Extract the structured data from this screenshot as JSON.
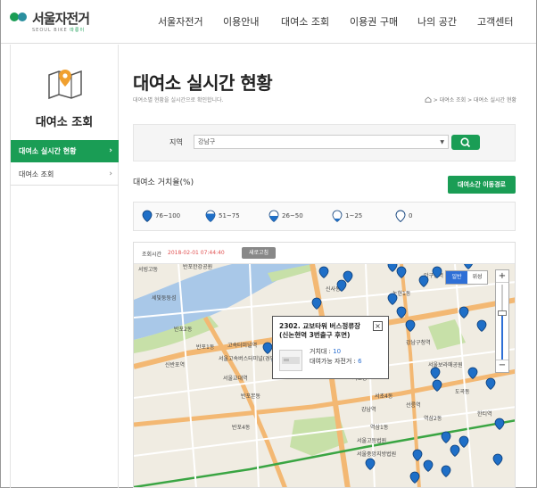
{
  "header": {
    "logo_text": "서울자전거",
    "logo_sub": "SEOUL BIKE",
    "logo_sub_brand": "따릉이",
    "nav": [
      "서울자전거",
      "이용안내",
      "대여소 조회",
      "이용권 구매",
      "나의 공간",
      "고객센터"
    ]
  },
  "sidebar": {
    "title": "대여소 조회",
    "items": [
      {
        "label": "대여소 실시간 현황",
        "active": true
      },
      {
        "label": "대여소 조회",
        "active": false
      }
    ]
  },
  "main": {
    "title": "대여소 실시간 현황",
    "subtitle": "대여소별 현황을 실시간으로 확인합니다.",
    "breadcrumb": "> 대여소 조회 > 대여소 실시간 현황",
    "search": {
      "label": "지역",
      "value": "강남구"
    },
    "rate_label": "대여소 거치율(%)",
    "route_button": "대여소간 이동경로",
    "legend": [
      "76~100",
      "51~75",
      "26~50",
      "1~25",
      "0"
    ]
  },
  "map": {
    "query_label": "조회시간",
    "query_time": "2018-02-01 07:44:40",
    "refresh_button": "새로고침",
    "map_type_normal": "일반",
    "map_type_satellite": "위성",
    "zoom_plus": "+",
    "zoom_minus": "−",
    "zoom_level_fraction": 0.62,
    "popup": {
      "title_line1": "2302. 교보타워 버스정류장",
      "title_line2": "(신논현역 3번출구 후면)",
      "dock_label": "거치대 :",
      "dock_value": "10",
      "bikes_label": "대여가능 자전거 :",
      "bikes_value": "6",
      "close": "×"
    },
    "labels": [
      "서빙고동",
      "반포한강공원",
      "세빛둥둥섬",
      "반포2동",
      "반포1동",
      "고속터미널역",
      "서울고속버스터미널(경부/영동선)",
      "신반포역",
      "반포본동",
      "반포4동",
      "서초동",
      "사평역",
      "신논현역",
      "강남역",
      "역삼1동",
      "역삼2동",
      "선릉역",
      "한티역",
      "서울보라매공원",
      "서울고등법원",
      "서울중앙지방법원",
      "도곡동",
      "서초4동",
      "강남구청역",
      "논현1동",
      "신사동",
      "압구정역",
      "서울교대역"
    ],
    "colors": {
      "pin": "#1f6fc7",
      "water": "#a9c8e8",
      "park": "#c7e0a8",
      "road_major": "#f3b873",
      "road_minor": "#ffffff",
      "land": "#f0ece2",
      "subway": "#3aa543"
    }
  },
  "colors": {
    "brand_green": "#1a9d55",
    "accent_red": "#e05050"
  }
}
